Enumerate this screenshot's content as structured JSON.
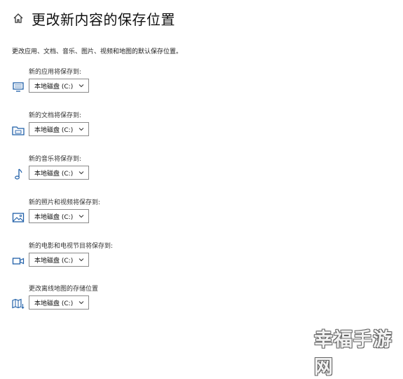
{
  "header": {
    "title": "更改新内容的保存位置",
    "icon": "home-icon"
  },
  "description": "更改应用、文档、音乐、图片、视频和地图的默认保存位置。",
  "sections": [
    {
      "label": "新的应用将保存到:",
      "value": "本地磁盘 (C:)",
      "icon": "monitor-icon"
    },
    {
      "label": "新的文档将保存到:",
      "value": "本地磁盘 (C:)",
      "icon": "folder-icon"
    },
    {
      "label": "新的音乐将保存到:",
      "value": "本地磁盘 (C:)",
      "icon": "music-note-icon"
    },
    {
      "label": "新的照片和视频将保存到:",
      "value": "本地磁盘 (C:)",
      "icon": "picture-icon"
    },
    {
      "label": "新的电影和电视节目将保存到:",
      "value": "本地磁盘 (C:)",
      "icon": "video-camera-icon"
    },
    {
      "label": "更改离线地图的存储位置",
      "value": "本地磁盘 (C:)",
      "icon": "map-icon"
    }
  ],
  "watermark": "幸福手游网",
  "colors": {
    "icon_accent": "#1f5fa8",
    "text": "#1a1a1a"
  }
}
